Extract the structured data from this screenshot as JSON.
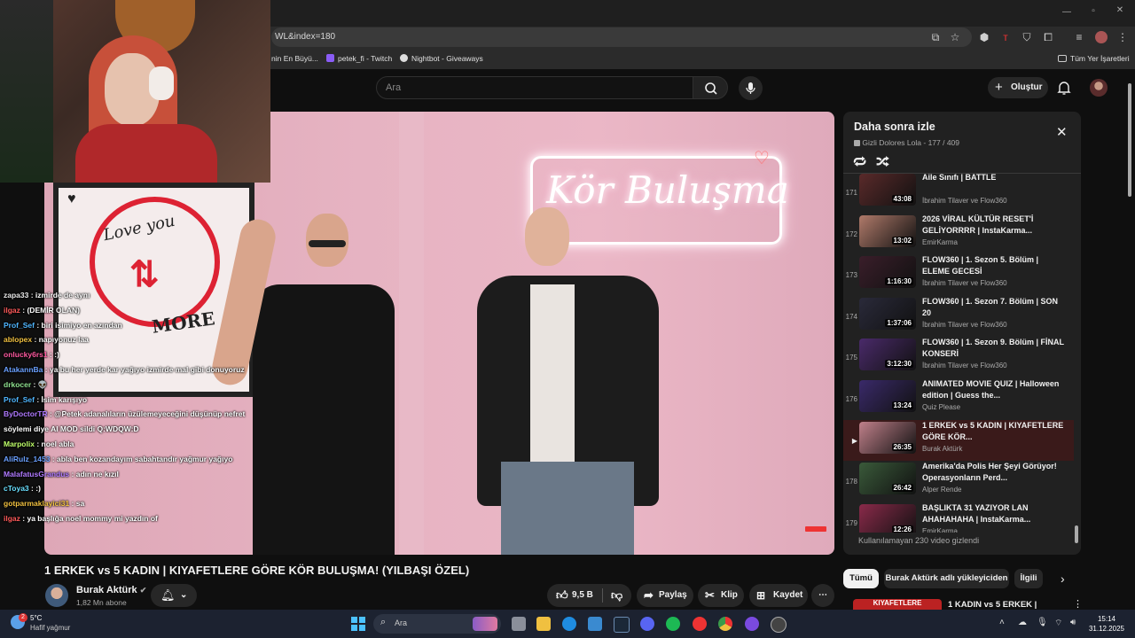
{
  "browser": {
    "url_fragment": "WL&index=180",
    "bookmarks": [
      {
        "label": "nin En Büyü..."
      },
      {
        "label": "petek_fi - Twitch"
      },
      {
        "label": "Nightbot - Giveaways"
      }
    ],
    "all_bookmarks_label": "Tüm Yer İşaretleri"
  },
  "header": {
    "search_placeholder": "Ara",
    "create_label": "Oluştur"
  },
  "video": {
    "title": "1 ERKEK vs 5 KADIN | KIYAFETLERE GÖRE KÖR BULUŞMA! (YILBAŞI ÖZEL)",
    "sign_text": "Kör Buluşma",
    "poster_top": "Love you",
    "poster_bottom": "MORE"
  },
  "channel": {
    "name": "Burak Aktürk",
    "subscribers": "1,82 Mn abone"
  },
  "actions": {
    "likes": "9,5 B",
    "share": "Paylaş",
    "clip": "Klip",
    "save": "Kaydet"
  },
  "chat": [
    {
      "user": "zapa33",
      "message": "izmirde de aynı",
      "color": "#e9e9e9"
    },
    {
      "user": "ilgaz",
      "message": "(DEMİR OLAN)",
      "color": "#ff5a5a"
    },
    {
      "user": "Prof_Sef",
      "message": "biri isimiyo en azından",
      "color": "#4fb6ff"
    },
    {
      "user": "ablopex",
      "message": "napıyonuz laa",
      "color": "#f0c040"
    },
    {
      "user": "onlucky6rs1",
      "message": ":)",
      "color": "#ff5aa0"
    },
    {
      "user": "AtakannBa",
      "message": "ya bu her yerde kar yağıyo izmirde mal gibi donuyoruz",
      "color": "#6aa0ff"
    },
    {
      "user": "drkocer",
      "message": "👽",
      "color": "#8fe08f"
    },
    {
      "user": "Prof_Sef",
      "message": "İsim karışıyo",
      "color": "#4fb6ff"
    },
    {
      "user": "ByDoctorTR",
      "message": "@Petek adanalıların üzülemeyeceğini düşünüp nefret",
      "color": "#b07aff"
    },
    {
      "user": "",
      "message": "söylemi diye AI MOD sildi Q:WDQW:D",
      "color": "#ffffff"
    },
    {
      "user": "Marpolix",
      "message": "noel abla",
      "color": "#bfff6a"
    },
    {
      "user": "AliRulz_1453",
      "message": "abla ben kozandayım sabahtandır yağmur yağıyo",
      "color": "#6aa0ff"
    },
    {
      "user": "MalafatusGrandus",
      "message": "adın ne kızıl",
      "color": "#b07aff"
    },
    {
      "user": "cToya3",
      "message": ":)",
      "color": "#6ae0ff"
    },
    {
      "user": "gotparmaklayici31",
      "message": "sa",
      "color": "#f0c040"
    },
    {
      "user": "ilgaz",
      "message": "ya başlığa noel mommy mi yazdın of",
      "color": "#ff5a5a"
    }
  ],
  "playlist": {
    "title": "Daha sonra izle",
    "privacy_owner": "Gizli Dolores Lola",
    "position": "177 / 409",
    "items": [
      {
        "index": "171",
        "title": "Aile Sınıfı | BATTLE",
        "channel": "İbrahim Tilaver ve Flow360",
        "duration": "43:08",
        "thumb": "#5a2a2a"
      },
      {
        "index": "172",
        "title": "2026 VİRAL KÜLTÜR RESET'İ GELİYORRRR | InstaKarma...",
        "channel": "EmirKarma",
        "duration": "13:02",
        "thumb": "#b07a6a"
      },
      {
        "index": "173",
        "title": "FLOW360 | 1. Sezon 5. Bölüm | ELEME GECESİ",
        "channel": "İbrahim Tilaver ve Flow360",
        "duration": "1:16:30",
        "thumb": "#3a1e2a"
      },
      {
        "index": "174",
        "title": "FLOW360 | 1. Sezon 7. Bölüm | SON 20",
        "channel": "İbrahim Tilaver ve Flow360",
        "duration": "1:37:06",
        "thumb": "#2a2a3a"
      },
      {
        "index": "175",
        "title": "FLOW360 | 1. Sezon 9. Bölüm | FİNAL KONSERİ",
        "channel": "İbrahim Tilaver ve Flow360",
        "duration": "3:12:30",
        "thumb": "#4a2a6a"
      },
      {
        "index": "176",
        "title": "ANIMATED MOVIE QUIZ | Halloween edition | Guess the...",
        "channel": "Quiz Please",
        "duration": "13:24",
        "thumb": "#3a2a6a"
      },
      {
        "index": "",
        "title": "1 ERKEK vs 5 KADIN | KIYAFETLERE GÖRE KÖR...",
        "channel": "Burak Aktürk",
        "duration": "26:35",
        "thumb": "#c0808a",
        "active": true
      },
      {
        "index": "178",
        "title": "Amerika'da Polis Her Şeyi Görüyor! Operasyonların Perd...",
        "channel": "Alper Rende",
        "duration": "26:42",
        "thumb": "#3a5a3a"
      },
      {
        "index": "179",
        "title": "BAŞLIKTA 31 YAZIYOR LAN AHAHAHAHA | InstaKarma...",
        "channel": "EmirKarma",
        "duration": "12:26",
        "thumb": "#8a2a4a"
      }
    ],
    "hidden_note": "Kullanılamayan 230 video gizlendi"
  },
  "chips": [
    "Tümü",
    "Burak Aktürk adlı yükleyiciden",
    "İlgili"
  ],
  "next_rec": {
    "title": "1 KADIN vs 5 ERKEK |",
    "thumb_text": "KIYAFETLERE"
  },
  "taskbar": {
    "weather_temp": "5°C",
    "weather_desc": "Hafif yağmur",
    "search_placeholder": "Ara",
    "time": "15:14",
    "date": "31.12.2025",
    "notification_badge": "2"
  }
}
